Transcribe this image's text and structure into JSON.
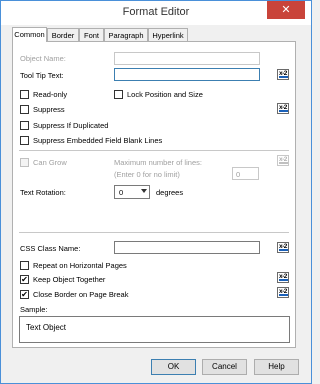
{
  "window": {
    "title": "Format Editor",
    "close_glyph": "✕"
  },
  "tabs": [
    {
      "label": "Common"
    },
    {
      "label": "Border"
    },
    {
      "label": "Font"
    },
    {
      "label": "Paragraph"
    },
    {
      "label": "Hyperlink"
    }
  ],
  "form": {
    "object_name_label": "Object Name:",
    "object_name_value": "",
    "tooltip_label": "Tool Tip Text:",
    "tooltip_value": "",
    "read_only": {
      "label": "Read-only",
      "checked": false
    },
    "lock_position": {
      "label": "Lock Position and Size",
      "checked": false
    },
    "suppress": {
      "label": "Suppress",
      "checked": false
    },
    "suppress_dup": {
      "label": "Suppress If Duplicated",
      "checked": false
    },
    "suppress_blank": {
      "label": "Suppress Embedded Field Blank Lines",
      "checked": false
    },
    "can_grow": {
      "label": "Can Grow",
      "checked": false
    },
    "max_lines_label_1": "Maximum number of lines:",
    "max_lines_label_2": "(Enter 0 for no limit)",
    "max_lines_value": "0",
    "text_rotation_label": "Text Rotation:",
    "text_rotation_value": "0",
    "degrees_label": "degrees",
    "css_label": "CSS Class Name:",
    "css_value": "",
    "repeat_pages": {
      "label": "Repeat on Horizontal Pages",
      "checked": false
    },
    "keep_together": {
      "label": "Keep Object Together",
      "checked": true
    },
    "close_border": {
      "label": "Close Border on Page Break",
      "checked": true
    },
    "check_glyph": "✔",
    "formula_glyph": "x-2",
    "sample_label": "Sample:",
    "sample_text": "Text Object"
  },
  "buttons": {
    "ok": "OK",
    "cancel": "Cancel",
    "help": "Help"
  }
}
